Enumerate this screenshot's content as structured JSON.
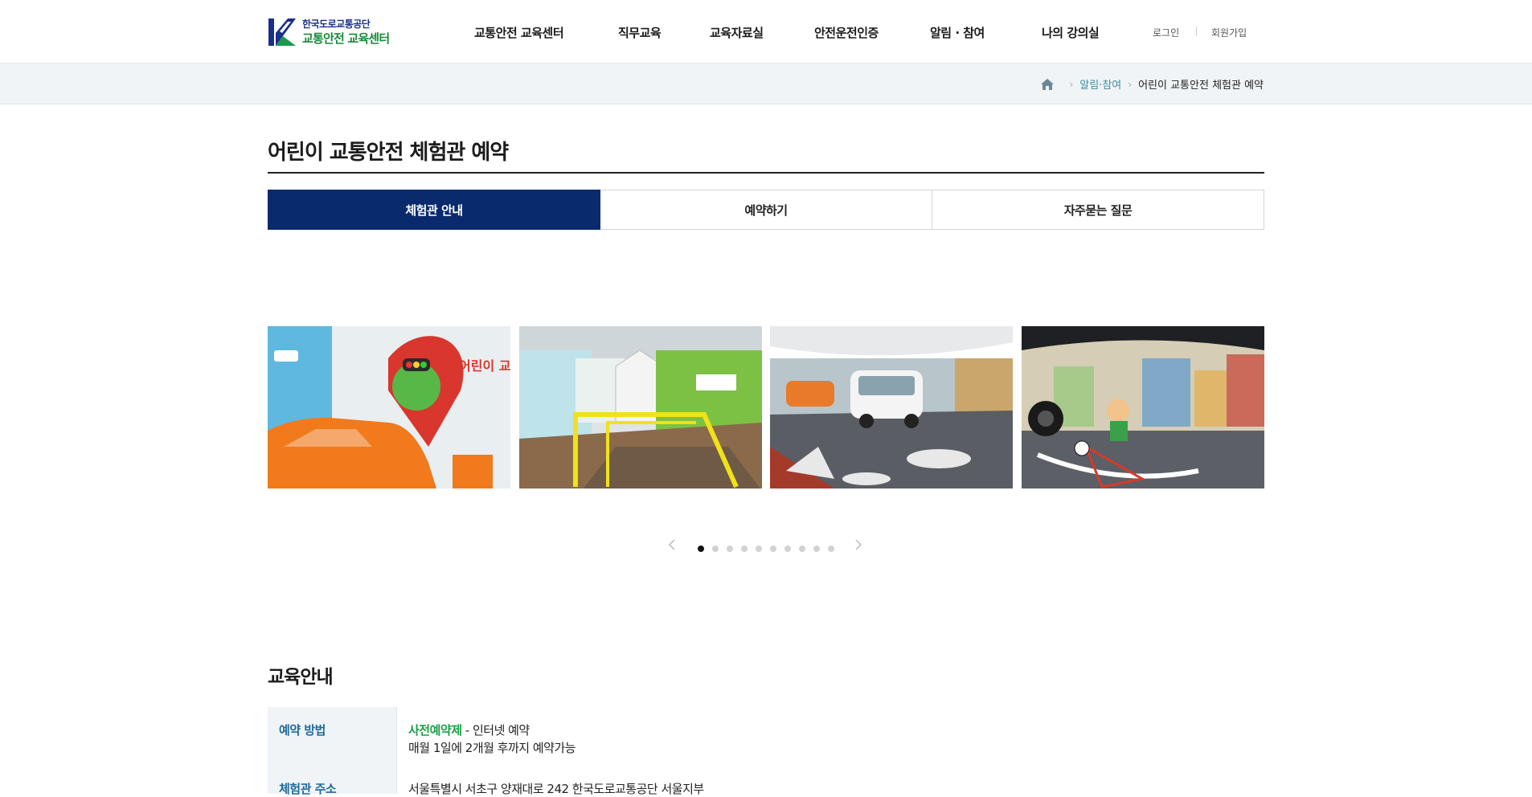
{
  "header": {
    "logo": {
      "org": "한국도로교통공단",
      "center": "교통안전 교육센터"
    },
    "nav": [
      "교통안전 교육센터",
      "직무교육",
      "교육자료실",
      "안전운전인증",
      "알림 · 참여",
      "나의 강의실"
    ],
    "util": {
      "login": "로그인",
      "signup": "회원가입"
    }
  },
  "breadcrumb": {
    "parent": "알림·참여",
    "current": "어린이 교통안전 체험관 예약"
  },
  "page_title": "어린이 교통안전 체험관 예약",
  "tabs": [
    {
      "label": "체험관 안내",
      "active": true
    },
    {
      "label": "예약하기",
      "active": false
    },
    {
      "label": "자주묻는 질문",
      "active": false
    }
  ],
  "gallery": {
    "slide1_sign": "어린이 교통안전 체험관",
    "dots_total": 10,
    "active_dot": 1
  },
  "education": {
    "title": "교육안내",
    "rows": [
      {
        "label": "예약 방법",
        "highlight": "사전예약제",
        "line1_rest": " - 인터넷 예약",
        "line2": "매월 1일에 2개월 후까지 예약가능"
      },
      {
        "label": "체험관 주소",
        "line1": "서울특별시 서초구 양재대로 242 한국도로교통공단 서울지부"
      }
    ]
  },
  "colors": {
    "accent_navy": "#0a2a6e",
    "green": "#1aa04a",
    "teal_link": "#3d8f9c",
    "label_blue": "#1e6a9c"
  }
}
